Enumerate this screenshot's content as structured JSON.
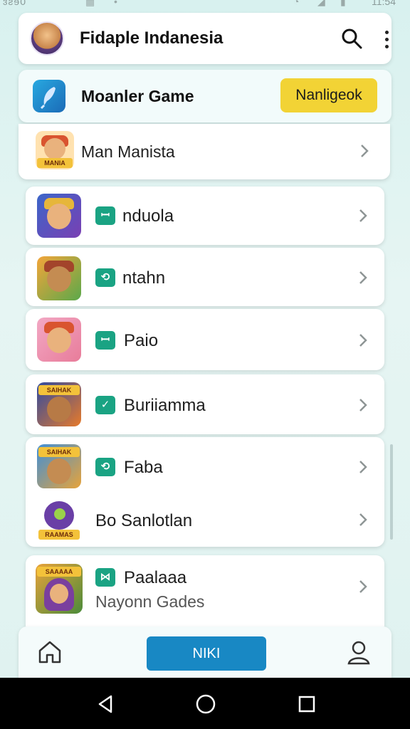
{
  "status_bar": {
    "left_text": "ɜƨɘ0",
    "time": "11:54"
  },
  "header": {
    "title": "Fidaple Indanesia"
  },
  "game_bar": {
    "title": "Moanler Game",
    "action_label": "Nanligeok"
  },
  "first_row": {
    "label": "Man Manista",
    "banner": "MANIA"
  },
  "items": [
    {
      "tag": "ꟷ",
      "label": "nduola",
      "sub": "",
      "banner": ""
    },
    {
      "tag": "⟲",
      "label": "ntahn",
      "sub": "",
      "banner": ""
    },
    {
      "tag": "ꟷ",
      "label": "Paio",
      "sub": "",
      "banner": ""
    },
    {
      "tag": "✓",
      "label": "Buriiamma",
      "sub": "",
      "banner": "SAIHAK"
    },
    {
      "tag": "⟲",
      "label": "Faba",
      "sub": "",
      "banner": "SAIHAK"
    },
    {
      "tag": "",
      "label": "Bo Sanlotlan",
      "sub": "",
      "banner": "RAAMAS"
    },
    {
      "tag": "⋈",
      "label": "Paalaaa",
      "sub": "Nayonn Gades",
      "banner": "SAAAAA"
    }
  ],
  "bottom_nav": {
    "primary_label": "NIKI"
  },
  "colors": {
    "accent": "#1888c4",
    "tag": "#1aa383",
    "action": "#f2d335",
    "background": "#d8f1ef"
  }
}
